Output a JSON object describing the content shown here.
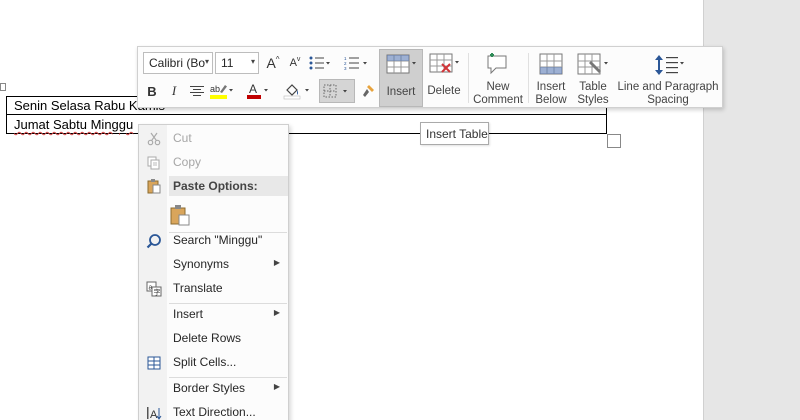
{
  "document": {
    "row1_text": "Senin Selasa Rabu Kamis",
    "row2_text": "Jumat Sabtu Minggu"
  },
  "mini_toolbar": {
    "font_name": "Calibri (Bo",
    "font_size": "11",
    "insert_label": "Insert",
    "delete_label": "Delete",
    "new_comment_line1": "New",
    "new_comment_line2": "Comment",
    "insert_below_line1": "Insert",
    "insert_below_line2": "Below",
    "table_styles_line1": "Table",
    "table_styles_line2": "Styles",
    "line_spacing_line1": "Line and Paragraph",
    "line_spacing_line2": "Spacing",
    "bold": "B",
    "italic": "I",
    "font_color_letter": "A",
    "highlight_color": "#ffff00",
    "font_color": "#c00000"
  },
  "tooltip": {
    "text": "Insert Table"
  },
  "context_menu": {
    "cut": "Cut",
    "copy": "Copy",
    "paste_options": "Paste Options:",
    "search": "Search \"Minggu\"",
    "synonyms": "Synonyms",
    "translate": "Translate",
    "insert": "Insert",
    "delete_rows": "Delete Rows",
    "split_cells": "Split Cells...",
    "border_styles": "Border Styles",
    "text_direction": "Text Direction..."
  },
  "icons": {
    "cut": "scissors-icon",
    "copy": "copy-icon",
    "paste": "clipboard-icon",
    "search": "search-icon",
    "translate": "translate-icon",
    "split_cells": "split-cells-icon",
    "text_direction": "text-direction-icon"
  }
}
